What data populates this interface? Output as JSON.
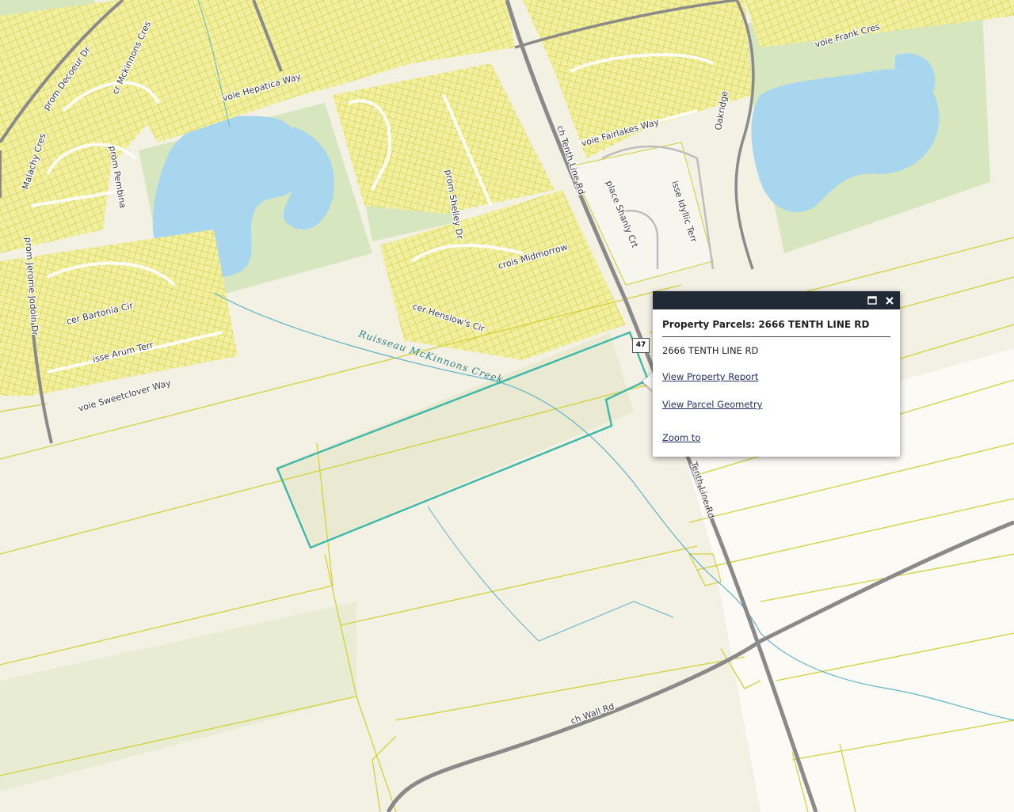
{
  "colors": {
    "background": "#f3f0e4",
    "parcel_lines": "#cfcd3a",
    "residential_fill": "#f1ef9c",
    "park_fill": "#d6e6bf",
    "water": "#a8d6ee",
    "major_road": "#8a8a8a",
    "minor_road": "#bdbdbd",
    "selected_parcel": "#3db8a8",
    "creek": "#5fb3c6",
    "popup_header": "#1f2a36"
  },
  "street_labels": {
    "decoeur": "prom Decoeur Dr",
    "hepatica": "voie Hepatica Way",
    "mckinnons": "cr Mckinnons Cres",
    "pembina": "prom Pembina",
    "mckinnons_creek": "Ruisseau McKinnons Creek",
    "tenth_line_north": "ch Tenth Line Rd",
    "tenth_line_south": "Tenth Line Rd",
    "wall_rd": "ch Wall Rd",
    "fairlakes": "voie Fairlakes Way",
    "jerome": "prom Jerome Jodoin Dr",
    "bartonia": "cer Bartonia Cir",
    "arum": "isse Arum Terr",
    "sweetclover": "voie Sweetclover Way",
    "henslows": "cer Henslow's Cir",
    "shelley": "prom Shelley Dr",
    "midmorrow": "crois Midmorrow",
    "shanly": "place Shanly Crt",
    "idyllic": "isse Idyllic Terr",
    "oakbridge": "Oakridge",
    "frank": "voie Frank Cres",
    "malachy": "Malachy Cres"
  },
  "popup": {
    "title": "Property Parcels: 2666 TENTH LINE RD",
    "address": "2666 TENTH LINE RD",
    "links": [
      "View Property Report",
      "View Parcel Geometry",
      "Zoom to"
    ],
    "maximize_icon": "maximize-icon",
    "close_icon": "close-icon"
  },
  "road_shield": "47"
}
